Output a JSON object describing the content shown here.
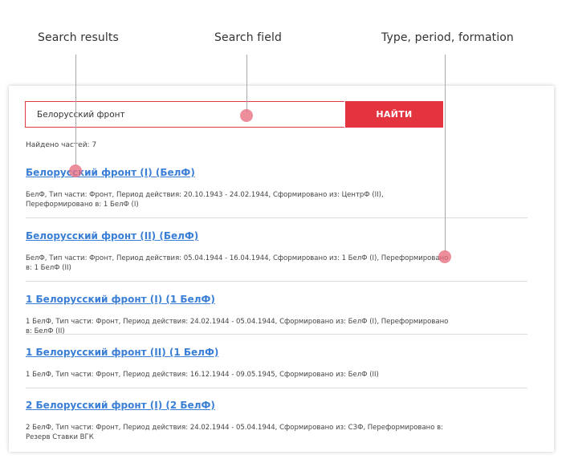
{
  "callouts": {
    "search_results": "Search results",
    "search_field": "Search field",
    "type_period_formation": "Type, period, formation"
  },
  "search": {
    "value": "Белорусский фронт",
    "button_label": "НАЙТИ"
  },
  "found_text": "Найдено частей: 7",
  "results": [
    {
      "title": "Белорусский фронт (I) (БелФ)",
      "desc": "БелФ, Тип части: Фронт, Период действия: 20.10.1943 - 24.02.1944, Сформировано из: ЦентрФ (II), Переформировано в: 1 БелФ (I)"
    },
    {
      "title": "Белорусский фронт (II) (БелФ)",
      "desc": "БелФ, Тип части: Фронт, Период действия: 05.04.1944 - 16.04.1944, Сформировано из: 1 БелФ (I), Переформировано в: 1 БелФ (II)"
    },
    {
      "title": "1 Белорусский фронт (I) (1 БелФ)",
      "desc": "1 БелФ, Тип части: Фронт, Период действия: 24.02.1944 - 05.04.1944, Сформировано из: БелФ (I), Переформировано в: БелФ (II)"
    },
    {
      "title": "1 Белорусский фронт (II) (1 БелФ)",
      "desc": "1 БелФ, Тип части: Фронт, Период действия: 16.12.1944 - 09.05.1945, Сформировано из: БелФ (II)"
    },
    {
      "title": "2 Белорусский фронт (I) (2 БелФ)",
      "desc": "2 БелФ, Тип части: Фронт, Период действия: 24.02.1944 - 05.04.1944, Сформировано из: СЗФ, Переформировано в: Резерв Ставки ВГК"
    }
  ],
  "colors": {
    "accent": "#e3343f",
    "link": "#3a7fd5",
    "marker": "#e86e82"
  }
}
